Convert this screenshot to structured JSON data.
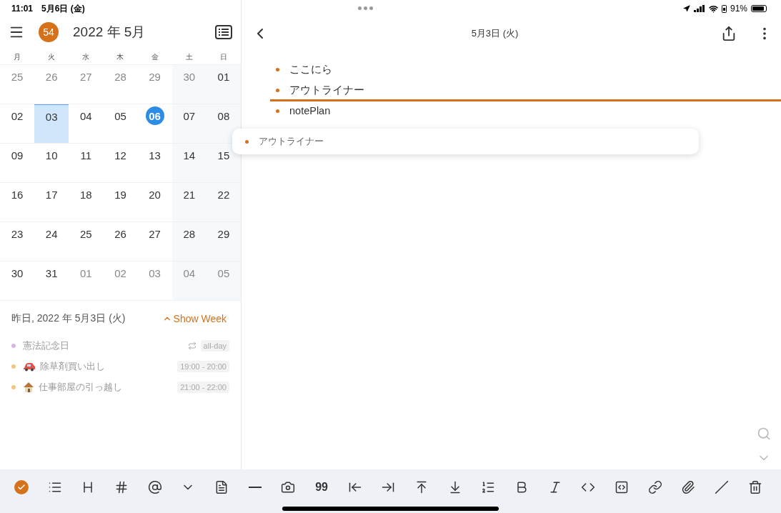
{
  "status_bar": {
    "time": "11:01",
    "date": "5月6日 (金)",
    "battery": "91%"
  },
  "calendar": {
    "badge": "54",
    "title": "2022 年 5月",
    "weekdays": [
      "月",
      "火",
      "水",
      "木",
      "金",
      "土",
      "日"
    ],
    "weeks": [
      [
        {
          "day": "25",
          "muted": true,
          "selected": false,
          "today": false
        },
        {
          "day": "26",
          "muted": true,
          "selected": false,
          "today": false
        },
        {
          "day": "27",
          "muted": true,
          "selected": false,
          "today": false
        },
        {
          "day": "28",
          "muted": true,
          "selected": false,
          "today": false
        },
        {
          "day": "29",
          "muted": true,
          "selected": false,
          "today": false
        },
        {
          "day": "30",
          "muted": true,
          "selected": false,
          "today": false
        },
        {
          "day": "01",
          "muted": false,
          "selected": false,
          "today": false
        }
      ],
      [
        {
          "day": "02",
          "muted": false,
          "selected": false,
          "today": false
        },
        {
          "day": "03",
          "muted": false,
          "selected": true,
          "today": false
        },
        {
          "day": "04",
          "muted": false,
          "selected": false,
          "today": false
        },
        {
          "day": "05",
          "muted": false,
          "selected": false,
          "today": false
        },
        {
          "day": "06",
          "muted": false,
          "selected": false,
          "today": true
        },
        {
          "day": "07",
          "muted": false,
          "selected": false,
          "today": false
        },
        {
          "day": "08",
          "muted": false,
          "selected": false,
          "today": false
        }
      ],
      [
        {
          "day": "09",
          "muted": false,
          "selected": false,
          "today": false
        },
        {
          "day": "10",
          "muted": false,
          "selected": false,
          "today": false
        },
        {
          "day": "11",
          "muted": false,
          "selected": false,
          "today": false
        },
        {
          "day": "12",
          "muted": false,
          "selected": false,
          "today": false
        },
        {
          "day": "13",
          "muted": false,
          "selected": false,
          "today": false
        },
        {
          "day": "14",
          "muted": false,
          "selected": false,
          "today": false
        },
        {
          "day": "15",
          "muted": false,
          "selected": false,
          "today": false
        }
      ],
      [
        {
          "day": "16",
          "muted": false,
          "selected": false,
          "today": false
        },
        {
          "day": "17",
          "muted": false,
          "selected": false,
          "today": false
        },
        {
          "day": "18",
          "muted": false,
          "selected": false,
          "today": false
        },
        {
          "day": "19",
          "muted": false,
          "selected": false,
          "today": false
        },
        {
          "day": "20",
          "muted": false,
          "selected": false,
          "today": false
        },
        {
          "day": "21",
          "muted": false,
          "selected": false,
          "today": false
        },
        {
          "day": "22",
          "muted": false,
          "selected": false,
          "today": false
        }
      ],
      [
        {
          "day": "23",
          "muted": false,
          "selected": false,
          "today": false
        },
        {
          "day": "24",
          "muted": false,
          "selected": false,
          "today": false
        },
        {
          "day": "25",
          "muted": false,
          "selected": false,
          "today": false
        },
        {
          "day": "26",
          "muted": false,
          "selected": false,
          "today": false
        },
        {
          "day": "27",
          "muted": false,
          "selected": false,
          "today": false
        },
        {
          "day": "28",
          "muted": false,
          "selected": false,
          "today": false
        },
        {
          "day": "29",
          "muted": false,
          "selected": false,
          "today": false
        }
      ],
      [
        {
          "day": "30",
          "muted": false,
          "selected": false,
          "today": false
        },
        {
          "day": "31",
          "muted": false,
          "selected": false,
          "today": false
        },
        {
          "day": "01",
          "muted": true,
          "selected": false,
          "today": false
        },
        {
          "day": "02",
          "muted": true,
          "selected": false,
          "today": false
        },
        {
          "day": "03",
          "muted": true,
          "selected": false,
          "today": false
        },
        {
          "day": "04",
          "muted": true,
          "selected": false,
          "today": false
        },
        {
          "day": "05",
          "muted": true,
          "selected": false,
          "today": false
        }
      ]
    ]
  },
  "agenda": {
    "heading": "昨日, 2022 年 5月3日 (火)",
    "show_week": "Show Week",
    "events": [
      {
        "kind": "plain",
        "title": "憲法記念日",
        "time": "all-day",
        "repeat": true,
        "color": "#d8b4e6"
      },
      {
        "kind": "car",
        "title": "除草剤買い出し",
        "time": "19:00 - 20:00",
        "repeat": false,
        "color": "#f5c77e"
      },
      {
        "kind": "house",
        "title": "仕事部屋の引っ越し",
        "time": "21:00 - 22:00",
        "repeat": false,
        "color": "#f5c77e"
      }
    ]
  },
  "note": {
    "title": "5月3日 (火)",
    "items": [
      {
        "text": "ここにら",
        "drop_target": false
      },
      {
        "text": "アウトライナー",
        "drop_target": true
      },
      {
        "text": "notePlan",
        "drop_target": false
      }
    ],
    "drag_preview": "アウトライナー"
  },
  "toolbar": {
    "quote": "99",
    "task_checked": true
  }
}
